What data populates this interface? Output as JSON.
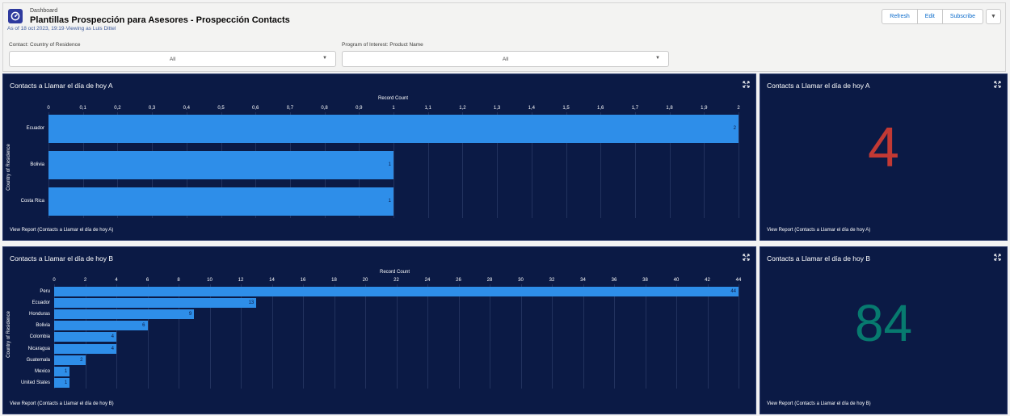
{
  "header": {
    "breadcrumb": "Dashboard",
    "title": "Plantillas Prospección para Asesores - Prospección Contacts",
    "as_of": "As of 18 oct 2023, 19:19·Viewing as Luis Dittel",
    "buttons": {
      "refresh": "Refresh",
      "edit": "Edit",
      "subscribe": "Subscribe"
    },
    "icon": "dashboard-app-icon"
  },
  "filters": [
    {
      "label": "Contact: Country of Residence",
      "value": "All"
    },
    {
      "label": "Program of Interest: Product Name",
      "value": "All"
    }
  ],
  "colors": {
    "panel_bg": "#0b1a45",
    "bar": "#2e8ee9",
    "metric_a": "#c23934",
    "metric_b": "#077a6f"
  },
  "panels": {
    "chart_a": {
      "title": "Contacts a Llamar el día de hoy A",
      "view_report": "View Report (Contacts a Llamar el día de hoy A)",
      "x_title": "Record Count",
      "y_title": "Country of Residence"
    },
    "metric_a": {
      "title": "Contacts a Llamar el día de hoy A",
      "value": "4",
      "view_report": "View Report (Contacts a Llamar el día de hoy A)"
    },
    "chart_b": {
      "title": "Contacts a Llamar el día de hoy B",
      "view_report": "View Report (Contacts a Llamar el día de hoy B)",
      "x_title": "Record Count",
      "y_title": "Country of Residence"
    },
    "metric_b": {
      "title": "Contacts a Llamar el día de hoy B",
      "value": "84",
      "view_report": "View Report (Contacts a Llamar el día de hoy B)"
    }
  },
  "chart_data": [
    {
      "type": "bar",
      "orientation": "horizontal",
      "title": "Contacts a Llamar el día de hoy A",
      "xlabel": "Record Count",
      "ylabel": "Country of Residence",
      "categories": [
        "Ecuador",
        "Bolivia",
        "Costa Rica"
      ],
      "values": [
        2,
        1,
        1
      ],
      "xlim": [
        0,
        2
      ],
      "ticks": [
        "0",
        "0,1",
        "0,2",
        "0,3",
        "0,4",
        "0,5",
        "0,6",
        "0,7",
        "0,8",
        "0,9",
        "1",
        "1,1",
        "1,2",
        "1,3",
        "1,4",
        "1,5",
        "1,6",
        "1,7",
        "1,8",
        "1,9",
        "2"
      ],
      "grid": true
    },
    {
      "type": "bar",
      "orientation": "horizontal",
      "title": "Contacts a Llamar el día de hoy B",
      "xlabel": "Record Count",
      "ylabel": "Country of Residence",
      "categories": [
        "Peru",
        "Ecuador",
        "Honduras",
        "Bolivia",
        "Colombia",
        "Nicaragua",
        "Guatemala",
        "Mexico",
        "United States"
      ],
      "values": [
        44,
        13,
        9,
        6,
        4,
        4,
        2,
        1,
        1
      ],
      "xlim": [
        0,
        44
      ],
      "ticks": [
        "0",
        "2",
        "4",
        "6",
        "8",
        "10",
        "12",
        "14",
        "16",
        "18",
        "20",
        "22",
        "24",
        "26",
        "28",
        "30",
        "32",
        "34",
        "36",
        "38",
        "40",
        "42",
        "44"
      ],
      "grid": true
    }
  ]
}
